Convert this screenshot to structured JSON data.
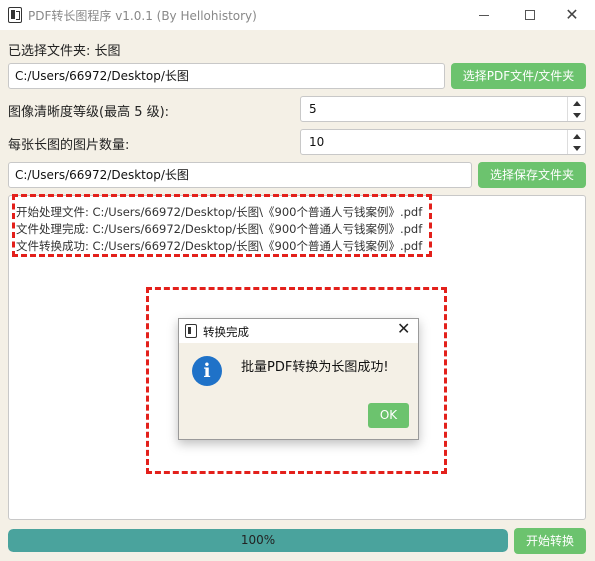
{
  "window": {
    "title": "PDF转长图程序 v1.0.1 (By Hellohistory)"
  },
  "form": {
    "selected_folder_label": "已选择文件夹: 长图",
    "source_path": "C:/Users/66972/Desktop/长图",
    "select_source_button": "选择PDF文件/文件夹",
    "clarity_label": "图像清晰度等级(最高 5 级):",
    "clarity_value": "5",
    "images_per_long_label": "每张长图的图片数量:",
    "images_per_long_value": "10",
    "save_path": "C:/Users/66972/Desktop/长图",
    "select_save_button": "选择保存文件夹"
  },
  "log": {
    "lines": [
      "开始处理文件: C:/Users/66972/Desktop/长图\\《900个普通人亏钱案例》.pdf",
      "文件处理完成: C:/Users/66972/Desktop/长图\\《900个普通人亏钱案例》.pdf",
      "文件转换成功: C:/Users/66972/Desktop/长图\\《900个普通人亏钱案例》.pdf"
    ]
  },
  "dialog": {
    "title": "转换完成",
    "message": "批量PDF转换为长图成功!",
    "ok_button": "OK"
  },
  "progress": {
    "value": 1.0,
    "text": "100%"
  },
  "actions": {
    "start_button": "开始转换"
  },
  "colors": {
    "accent_green": "#6cc36e",
    "progress_teal": "#4aa39d",
    "highlight_red": "#e3201b",
    "info_blue": "#1f72c8"
  }
}
